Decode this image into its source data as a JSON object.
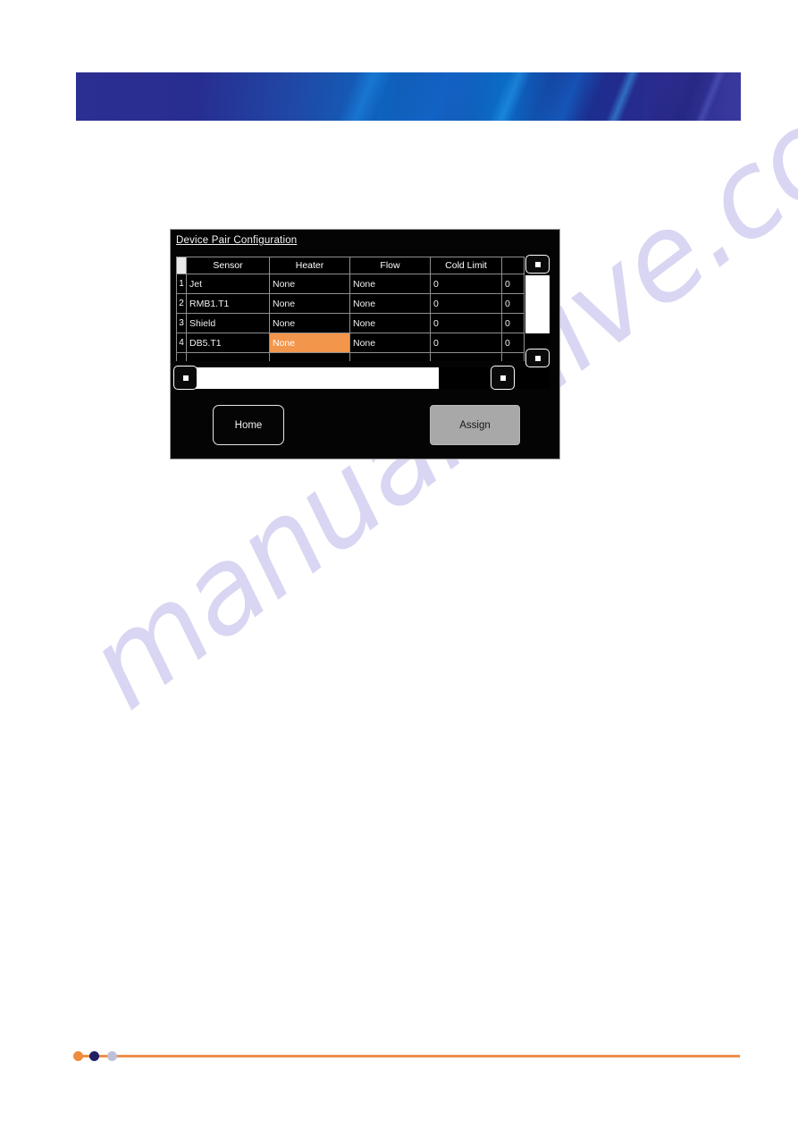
{
  "page": {
    "banner_title": "",
    "background_color": "#ffffff"
  },
  "watermark": {
    "text": "manualshive.com",
    "color": "#b9b6e8"
  },
  "device_screen": {
    "title": "Device Pair Configuration",
    "accent_color": "#f2964b",
    "grid": {
      "corner_label": "",
      "columns": [
        "Sensor",
        "Heater",
        "Flow",
        "Cold Limit",
        ""
      ],
      "rows": [
        {
          "number": "1",
          "sensor": "Jet",
          "heater": "None",
          "flow": "None",
          "cold_limit": "0",
          "extra": "0"
        },
        {
          "number": "2",
          "sensor": "RMB1.T1",
          "heater": "None",
          "flow": "None",
          "cold_limit": "0",
          "extra": "0"
        },
        {
          "number": "3",
          "sensor": "Shield",
          "heater": "None",
          "flow": "None",
          "cold_limit": "0",
          "extra": "0"
        },
        {
          "number": "4",
          "sensor": "DB5.T1",
          "heater": "None",
          "flow": "None",
          "cold_limit": "0",
          "extra": "0"
        }
      ],
      "selected_cell": {
        "row": 4,
        "column": "Heater",
        "value": "None"
      }
    },
    "scrollbars": {
      "vertical": {
        "up_icon": "scroll-up-icon",
        "down_icon": "scroll-down-icon"
      },
      "horizontal": {
        "left_icon": "scroll-left-icon",
        "right_icon": "scroll-right-icon"
      }
    },
    "buttons": {
      "home": "Home",
      "assign": "Assign"
    }
  },
  "footer": {
    "dots": [
      "#f08c3c",
      "#211f63",
      "#bfc0d8"
    ],
    "line_color": "#ef8f4c"
  }
}
